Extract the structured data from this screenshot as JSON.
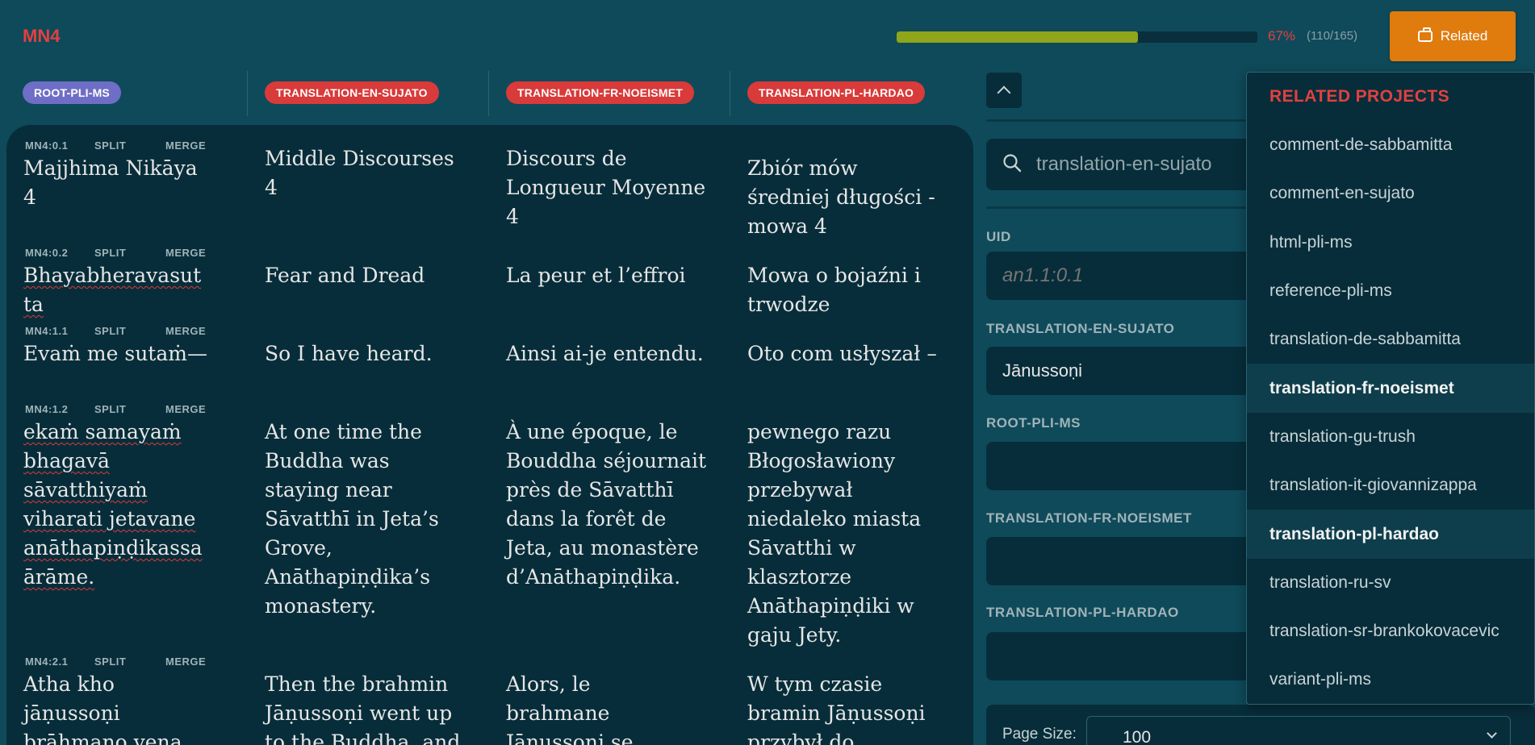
{
  "header": {
    "title": "MN4",
    "progress_fraction": 0.67,
    "progress_percent": "67%",
    "progress_count": "(110/165)",
    "related_label": "Related"
  },
  "columns": [
    {
      "label": "ROOT-PLI-MS",
      "kind": "root"
    },
    {
      "label": "TRANSLATION-EN-SUJATO",
      "kind": "translation"
    },
    {
      "label": "TRANSLATION-FR-NOEISMET",
      "kind": "translation"
    },
    {
      "label": "TRANSLATION-PL-HARDAO",
      "kind": "translation"
    }
  ],
  "actions": {
    "split": "SPLIT",
    "merge": "MERGE"
  },
  "segments": [
    {
      "uid": "MN4:0.1",
      "root": "Majjhima Nikāya 4",
      "en": "Middle Discourses 4",
      "fr": "Discours de Longueur Moyenne 4",
      "pl": "Zbiór mów średniej długości - mowa 4"
    },
    {
      "uid": "MN4:0.2",
      "root": "Bhayabheravasutta",
      "en": "Fear and Dread",
      "fr": "La peur et l’effroi",
      "pl": "Mowa o bojaźni i trwodze"
    },
    {
      "uid": "MN4:1.1",
      "root": "Evaṁ me sutaṁ—",
      "en": "So I have heard.",
      "fr": "Ainsi ai-je entendu.",
      "pl": "Oto com usłyszał –"
    },
    {
      "uid": "MN4:1.2",
      "root": "ekaṁ samayaṁ bhagavā sāvatthiyaṁ viharati jetavane anāthapiṇḍikassa ārāme.",
      "en": "At one time the Buddha was staying near Sāvatthī in Jeta’s Grove, Anāthapiṇḍika’s monastery.",
      "fr": "À une époque, le Bouddha séjournait près de Sāvatthī dans la forêt de Jeta, au monastère d’Anāthapiṇḍika.",
      "pl": "pewnego razu Błogosławiony przebywał niedaleko miasta Sāvatthi w klasztorze Anāthapiṇḍiki w gaju Jety."
    },
    {
      "uid": "MN4:2.1",
      "root": "Atha kho jāṇussoṇi brāhmaṇo yena",
      "en": "Then the brahmin Jāṇussoṇi went up to the Buddha, and",
      "fr": "Alors, le brahmane Jāṇussoṇi se",
      "pl": "W tym czasie bramin Jāṇussoṇi przybył do"
    }
  ],
  "search": {
    "value": "translation-en-sujato"
  },
  "editor": {
    "uid_label": "UID",
    "uid_value": "an1.1:0.1",
    "fields": [
      {
        "label": "TRANSLATION-EN-SUJATO",
        "value": "Jānussoṇi"
      },
      {
        "label": "ROOT-PLI-MS",
        "value": ""
      },
      {
        "label": "TRANSLATION-FR-NOEISMET",
        "value": ""
      },
      {
        "label": "TRANSLATION-PL-HARDAO",
        "value": ""
      }
    ],
    "page_size_label": "Page Size:",
    "page_size_value": "100"
  },
  "related": {
    "title": "RELATED PROJECTS",
    "items": [
      {
        "label": "comment-de-sabbamitta",
        "selected": false
      },
      {
        "label": "comment-en-sujato",
        "selected": false
      },
      {
        "label": "html-pli-ms",
        "selected": false
      },
      {
        "label": "reference-pli-ms",
        "selected": false
      },
      {
        "label": "translation-de-sabbamitta",
        "selected": false
      },
      {
        "label": "translation-fr-noeismet",
        "selected": true
      },
      {
        "label": "translation-gu-trush",
        "selected": false
      },
      {
        "label": "translation-it-giovannizappa",
        "selected": false
      },
      {
        "label": "translation-pl-hardao",
        "selected": true
      },
      {
        "label": "translation-ru-sv",
        "selected": false
      },
      {
        "label": "translation-sr-brankokovacevic",
        "selected": false
      },
      {
        "label": "variant-pli-ms",
        "selected": false
      }
    ]
  },
  "colors": {
    "accent_red": "#e24040",
    "orange": "#e07b0e",
    "progress_green": "#8fa51a",
    "root_pill": "#6f6ec6",
    "translation_pill": "#d93a3a"
  }
}
